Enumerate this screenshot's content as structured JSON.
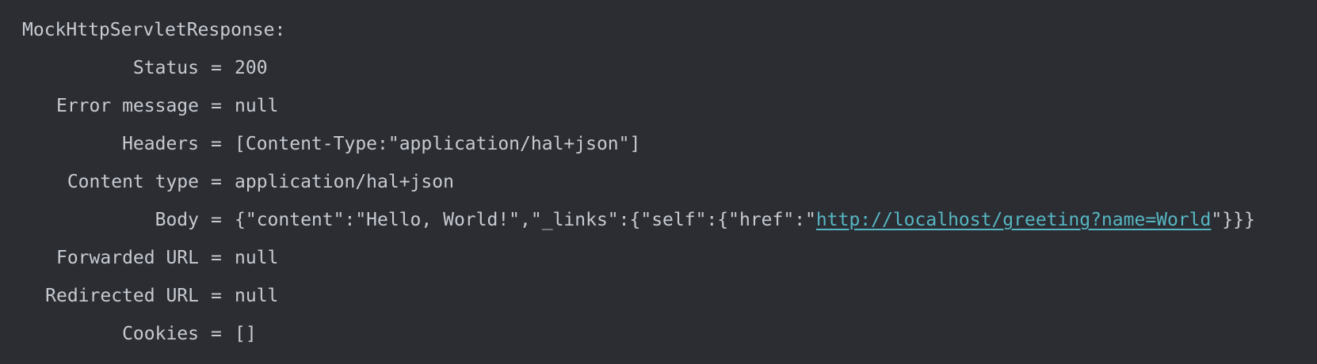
{
  "console": {
    "title": "MockHttpServletResponse:",
    "rows": [
      {
        "key": "Status",
        "value": "200"
      },
      {
        "key": "Error message",
        "value": "null"
      },
      {
        "key": "Headers",
        "value": "[Content-Type:\"application/hal+json\"]"
      },
      {
        "key": "Content type",
        "value": "application/hal+json"
      },
      {
        "key": "Body",
        "value_prefix": "{\"content\":\"Hello, World!\",\"_links\":{\"self\":{\"href\":\"",
        "link_text": "http://localhost/greeting?name=World",
        "value_suffix": "\"}}}"
      },
      {
        "key": "Forwarded URL",
        "value": "null"
      },
      {
        "key": "Redirected URL",
        "value": "null"
      },
      {
        "key": "Cookies",
        "value": "[]"
      }
    ],
    "equals_sign": "=",
    "colors": {
      "background": "#2b2d33",
      "text": "#c7cbd1",
      "link": "#56b6c2"
    }
  }
}
